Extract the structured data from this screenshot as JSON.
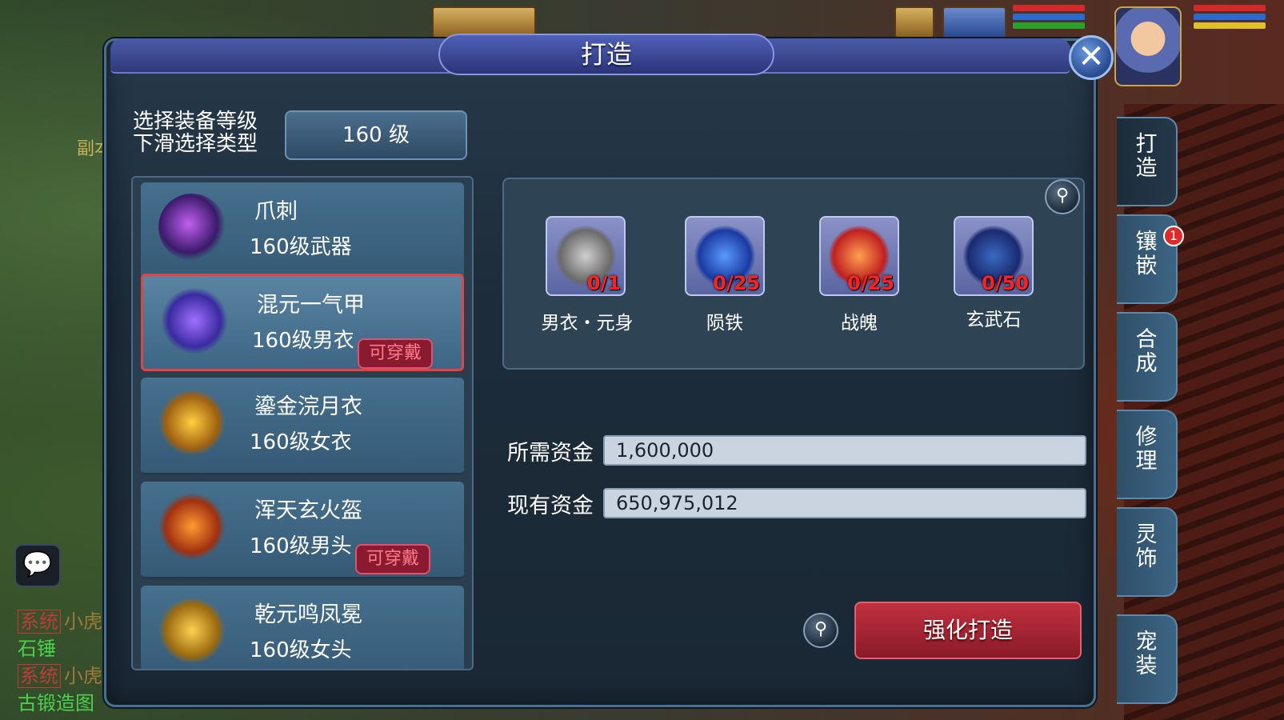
{
  "window": {
    "title": "打造"
  },
  "background": {
    "left_label": "副本",
    "chat": [
      {
        "tag": "系统",
        "who": "小虎",
        "text": "石锤"
      },
      {
        "tag": "系统",
        "who": "小虎",
        "text": "古锻造图"
      }
    ]
  },
  "level": {
    "label_line1": "选择装备等级",
    "label_line2": "下滑选择类型",
    "selected": "160 级"
  },
  "items": [
    {
      "name": "爪刺",
      "type": "160级武器",
      "wearable": "",
      "selected": false,
      "color": "#9a3ad0"
    },
    {
      "name": "混元一气甲",
      "type": "160级男衣",
      "wearable": "可穿戴",
      "selected": true,
      "color": "#5a5ae0"
    },
    {
      "name": "鎏金浣月衣",
      "type": "160级女衣",
      "wearable": "",
      "selected": false,
      "color": "#e0a020"
    },
    {
      "name": "浑天玄火盔",
      "type": "160级男头",
      "wearable": "可穿戴",
      "selected": false,
      "color": "#e06020"
    },
    {
      "name": "乾元鸣凤冕",
      "type": "160级女头",
      "wearable": "",
      "selected": false,
      "color": "#d0a020"
    }
  ],
  "materials": [
    {
      "name": "男衣・元身",
      "count": "0/1",
      "color": "#9a9a9a"
    },
    {
      "name": "陨铁",
      "count": "0/25",
      "color": "#1e5ae0"
    },
    {
      "name": "战魄",
      "count": "0/25",
      "color": "#e03a2a"
    },
    {
      "name": "玄武石",
      "count": "0/50",
      "color": "#2a5ab0"
    }
  ],
  "funds": {
    "required_label": "所需资金",
    "required_value": "1,600,000",
    "current_label": "现有资金",
    "current_value": "650,975,012"
  },
  "forge_button": "强化打造",
  "tabs": [
    {
      "label": "打造",
      "active": true
    },
    {
      "label": "镶嵌",
      "active": false,
      "badge": "1"
    },
    {
      "label": "合成",
      "active": false
    },
    {
      "label": "修理",
      "active": false
    },
    {
      "label": "灵饰",
      "active": false
    },
    {
      "label": "宠装",
      "active": false
    }
  ],
  "icons": {
    "close": "close-icon",
    "search": "magnifier-icon",
    "chat": "chat-bubble-icon"
  }
}
